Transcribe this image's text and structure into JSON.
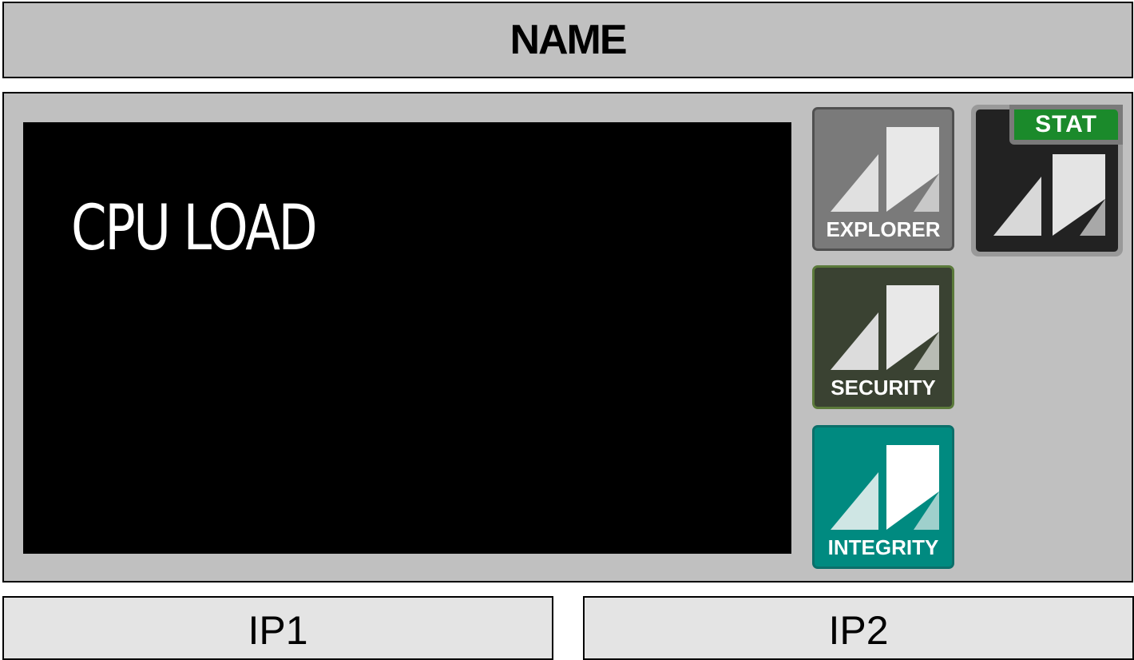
{
  "header": {
    "name": "NAME"
  },
  "screen": {
    "title": "CPU LOAD"
  },
  "apps": {
    "explorer": {
      "label": "EXPLORER"
    },
    "security": {
      "label": "SECURITY"
    },
    "integrity": {
      "label": "INTEGRITY"
    },
    "stat": {
      "badge": "STAT"
    }
  },
  "footer": {
    "ip1": "IP1",
    "ip2": "IP2"
  },
  "colors": {
    "panel_bg": "#c0c0c0",
    "explorer_bg": "#7a7a7a",
    "security_bg": "#3a4232",
    "integrity_bg": "#008a80",
    "stat_badge": "#1b8a2b"
  },
  "icons": {
    "app_logo": "split-panel-logo-icon"
  }
}
